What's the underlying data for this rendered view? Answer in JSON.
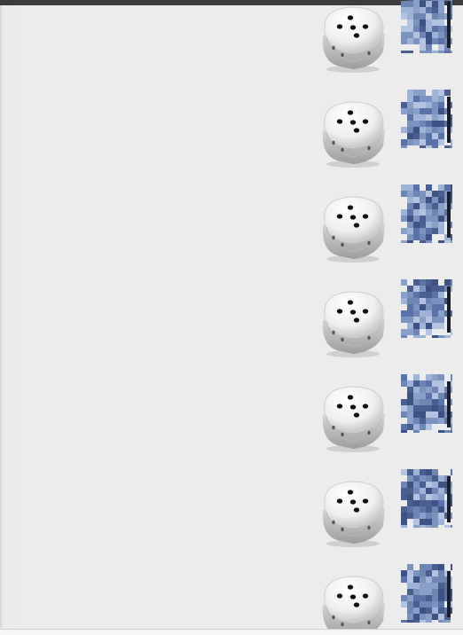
{
  "rows": [
    {
      "die_icon": "dice-five-icon",
      "thumbnail": "pixelated-blue-avatar"
    },
    {
      "die_icon": "dice-five-icon",
      "thumbnail": "pixelated-blue-avatar"
    },
    {
      "die_icon": "dice-five-icon",
      "thumbnail": "pixelated-blue-avatar"
    },
    {
      "die_icon": "dice-five-icon",
      "thumbnail": "pixelated-blue-avatar"
    },
    {
      "die_icon": "dice-five-icon",
      "thumbnail": "pixelated-blue-avatar"
    },
    {
      "die_icon": "dice-five-icon",
      "thumbnail": "pixelated-blue-avatar"
    },
    {
      "die_icon": "dice-five-icon",
      "thumbnail": "pixelated-blue-avatar"
    }
  ],
  "colors": {
    "background": "#ececec",
    "top_bar": "#3b3b3b",
    "die_face": "#f4f4f4",
    "pip": "#111111",
    "thumbnail_blue": "#6f86b5"
  }
}
